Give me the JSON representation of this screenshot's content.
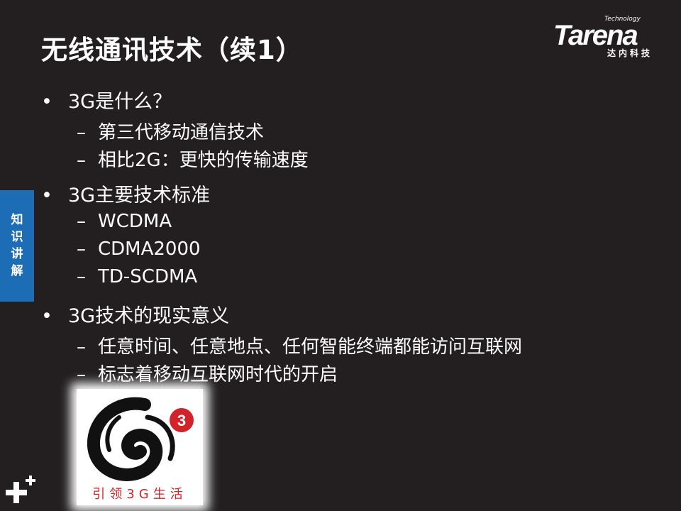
{
  "slide": {
    "title": "无线通讯技术（续1）"
  },
  "logo": {
    "brand": "Tarena",
    "tagline": "Technology",
    "chinese": "达内科技"
  },
  "side_tab": {
    "chars": [
      "知",
      "识",
      "讲",
      "解"
    ]
  },
  "bullets": [
    {
      "text": "3G是什么？",
      "sub": [
        "第三代移动通信技术",
        "相比2G：更快的传输速度"
      ]
    },
    {
      "text": "3G主要技术标准",
      "sub": [
        "WCDMA",
        "CDMA2000",
        "TD-SCDMA"
      ]
    },
    {
      "text": "3G技术的现实意义",
      "sub": [
        "任意时间、任意地点、任何智能终端都能访问互联网",
        "标志着移动互联网时代的开启"
      ]
    }
  ],
  "symbols": {
    "bullet": "•",
    "dash": "–"
  },
  "badge": {
    "number": "3",
    "caption": "引领3G生活"
  },
  "colors": {
    "background": "#231f20",
    "side_tab": "#1c6db5",
    "badge_red": "#d2232a"
  }
}
